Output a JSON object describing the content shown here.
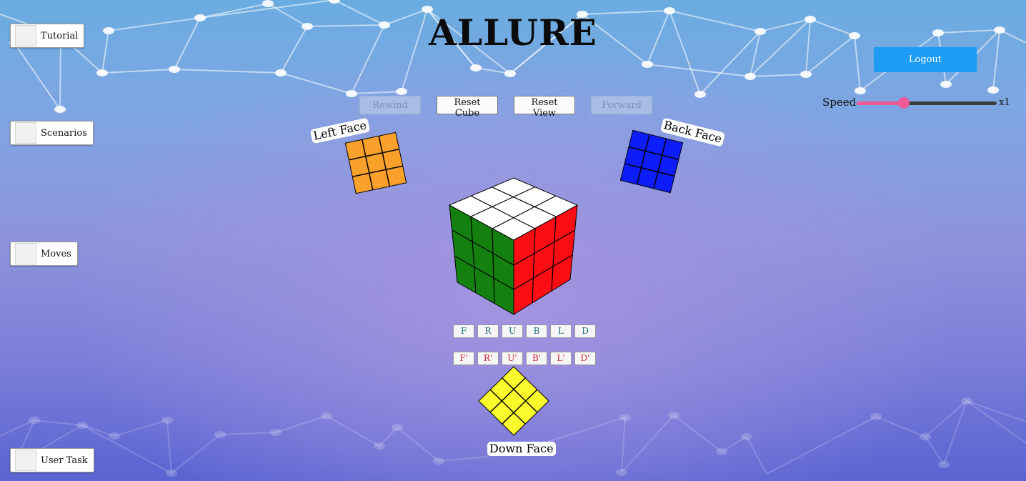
{
  "app": {
    "title": "ALLURE"
  },
  "sidebar": {
    "items": [
      {
        "label": "Tutorial"
      },
      {
        "label": "Scenarios"
      },
      {
        "label": "Moves"
      },
      {
        "label": "User Task"
      }
    ]
  },
  "header": {
    "logout_label": "Logout"
  },
  "speed": {
    "label": "Speed",
    "value_label": "x1",
    "level": 0.35,
    "fill_color": "#ee5b95"
  },
  "controls": {
    "rewind_label": "Rewind",
    "reset_cube_label": "Reset Cube",
    "reset_view_label": "Reset View",
    "forward_label": "Forward"
  },
  "faces": {
    "left_label": "Left Face",
    "back_label": "Back Face",
    "down_label": "Down Face",
    "colors": {
      "left": "#f9a12a",
      "back": "#0d1dfa",
      "down": "#fbfa2d",
      "front": "#13800f",
      "right": "#fb0d13",
      "up": "#ffffff"
    }
  },
  "moves": {
    "clockwise": [
      "F",
      "R",
      "U",
      "B",
      "L",
      "D"
    ],
    "counter_clockwise": [
      "F'",
      "R'",
      "U'",
      "B'",
      "L'",
      "D'"
    ]
  }
}
